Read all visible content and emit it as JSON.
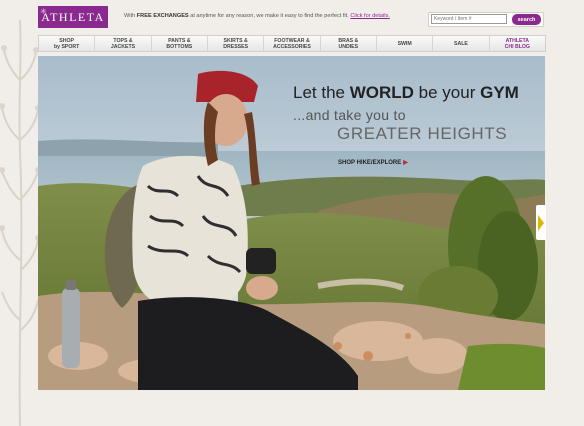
{
  "brand": {
    "logo_text": "ATHLETA",
    "accent_color": "#8a2a8e"
  },
  "promo": {
    "prefix": "With ",
    "bold": "FREE EXCHANGES",
    "suffix": " at anytime for any reason, we make it easy to find the perfect fit.",
    "link": "Click for details."
  },
  "search": {
    "placeholder": "Keyword / Item #",
    "button_label": "search"
  },
  "nav": {
    "items": [
      {
        "label": "SHOP\nby SPORT"
      },
      {
        "label": "TOPS &\nJACKETS"
      },
      {
        "label": "PANTS &\nBOTTOMS"
      },
      {
        "label": "SKIRTS &\nDRESSES"
      },
      {
        "label": "FOOTWEAR &\nACCESSORIES"
      },
      {
        "label": "BRAS &\nUNDIES"
      },
      {
        "label": "SWIM"
      },
      {
        "label": "SALE"
      },
      {
        "label": "ATHLETA\nCHI BLOG"
      }
    ]
  },
  "hero": {
    "line1_a": "Let the ",
    "line1_b": "WORLD",
    "line1_c": " be your ",
    "line1_d": "GYM",
    "line2": "...and take you to",
    "line3": "GREATER HEIGHTS",
    "cta": "SHOP HIKE/EXPLORE",
    "cta_arrow": "▶"
  }
}
